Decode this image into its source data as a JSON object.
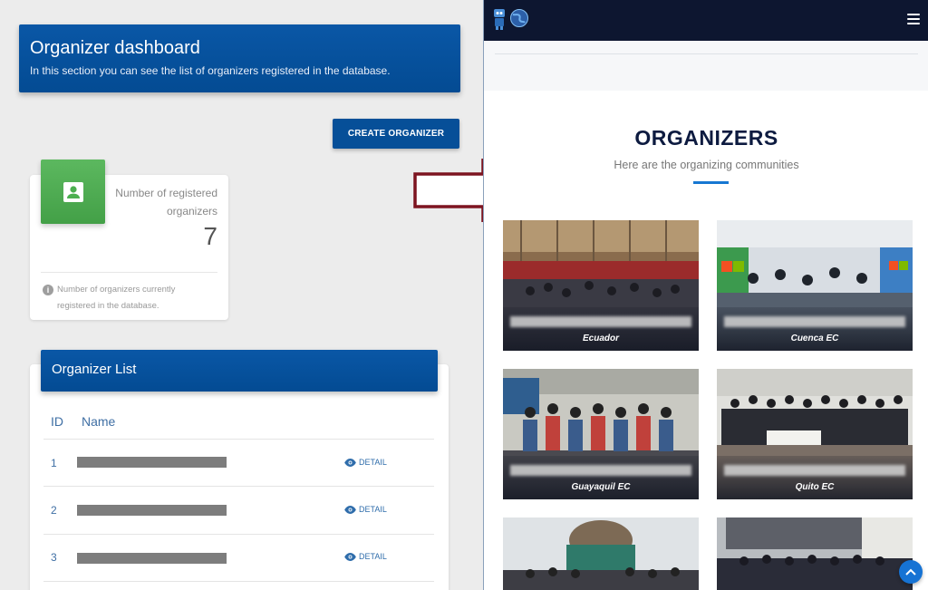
{
  "dashboard": {
    "title": "Organizer dashboard",
    "subtitle": "In this section you can see the list of organizers registered in the database.",
    "create_button": "CREATE ORGANIZER"
  },
  "stat": {
    "icon": "contact-card-icon",
    "label": "Number of registered organizers",
    "value": "7",
    "footnote": "Number of organizers currently registered in the database."
  },
  "list": {
    "title": "Organizer List",
    "columns": [
      "ID",
      "Name"
    ],
    "rows": [
      {
        "id": "1",
        "detail": "DETAIL"
      },
      {
        "id": "2",
        "detail": "DETAIL"
      },
      {
        "id": "3",
        "detail": "DETAIL"
      }
    ]
  },
  "site": {
    "section_title": "ORGANIZERS",
    "section_subtitle": "Here are the organizing communities",
    "organizers": [
      {
        "location": "Ecuador"
      },
      {
        "location": "Cuenca EC"
      },
      {
        "location": "Guayaquil EC"
      },
      {
        "location": "Quito EC"
      }
    ]
  },
  "colors": {
    "primary": "#034b93",
    "accent_green": "#4caf50",
    "navbar": "#0d1630",
    "arrow": "#7d1420",
    "link_blue": "#1677d2"
  }
}
